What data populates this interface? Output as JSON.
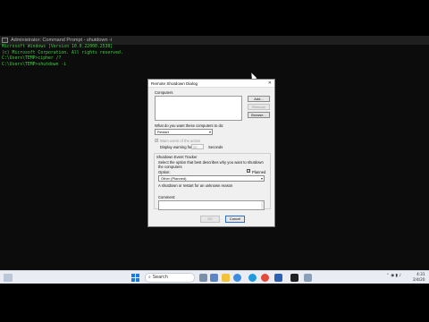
{
  "console": {
    "title": "Administrator: Command Prompt - shutdown -i",
    "lines": [
      "Microsoft Windows [Version 10.0.22000.2538]",
      "(c) Microsoft Corporation. All rights reserved.",
      "",
      "C:\\Users\\TEMP>cipher /?",
      "",
      "C:\\Users\\TEMP>shutdown -i"
    ]
  },
  "dialog": {
    "title": "Remote Shutdown Dialog",
    "close_glyph": "✕",
    "computers_label": "Computers",
    "add_button": "Add...",
    "remove_button": "Remove",
    "browse_button": "Browse...",
    "action_question": "What do you want these computers to do:",
    "action_selected": "Restart",
    "warn_users_label": "Warn users of the action",
    "display_warning_label": "Display warning for",
    "warning_seconds": "30",
    "seconds_label": "Seconds",
    "tracker_title": "Shutdown Event Tracker",
    "tracker_desc": "Select the option that best describes why you want to shutdown the computers",
    "option_label": "Option:",
    "planned_label": "Planned",
    "reason_selected": "Other (Planned)",
    "reason_desc": "A shutdown or restart for an unknown reason",
    "comment_label": "Comment:",
    "ok_button": "OK",
    "cancel_button": "Cancel"
  },
  "taskbar": {
    "search_placeholder": "Search",
    "clock_time": "4:31",
    "clock_date": "2/4/20"
  },
  "icons": {
    "start": "windows-start-icon",
    "search": "search-icon",
    "cursor": "mouse-pointer-icon"
  },
  "colors": {
    "console_text": "#3fd23f",
    "accent": "#1f7ae0"
  }
}
